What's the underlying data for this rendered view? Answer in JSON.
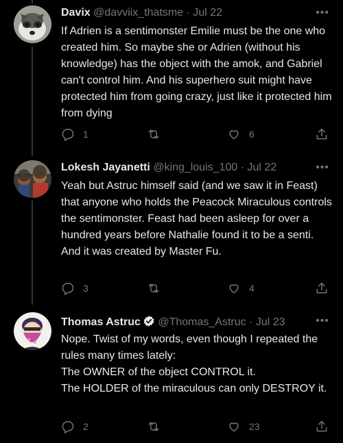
{
  "tweets": [
    {
      "name": "Davix",
      "handle": "@davviix_thatsme",
      "date": "Jul 22",
      "text": "If Adrien is a sentimonster Emilie must be the one who created him. So maybe she or Adrien (without his knowledge) has the object with the amok, and Gabriel can't control him. And his superhero suit might have protected him from going crazy, just like it protected him from dying",
      "replies": "1",
      "retweets": "",
      "likes": "6",
      "verified": false
    },
    {
      "name": "Lokesh Jayanetti",
      "handle": "@king_louis_100",
      "date": "Jul 22",
      "text": "Yeah but Astruc himself said (and we saw it in Feast) that anyone who holds the Peacock Miraculous controls the sentimonster. Feast had been asleep for over a hundred years before Nathalie found it to be a senti. And it was created by Master Fu.",
      "replies": "3",
      "retweets": "",
      "likes": "4",
      "verified": false
    },
    {
      "name": "Thomas Astruc",
      "handle": "@Thomas_Astruc",
      "date": "Jul 23",
      "text": "Nope. Twist of my words, even though I repeated the rules many times lately:\nThe OWNER of the object CONTROL it.\nThe HOLDER of the miraculous can only DESTROY it.",
      "replies": "2",
      "retweets": "",
      "likes": "23",
      "verified": true
    }
  ],
  "ui": {
    "separator": "·",
    "more": "•••"
  },
  "colors": {
    "background": "#000000",
    "text": "#e7e9ea",
    "secondary": "#71767b",
    "verified": "#1d9bf0",
    "thread_line": "#333639"
  }
}
